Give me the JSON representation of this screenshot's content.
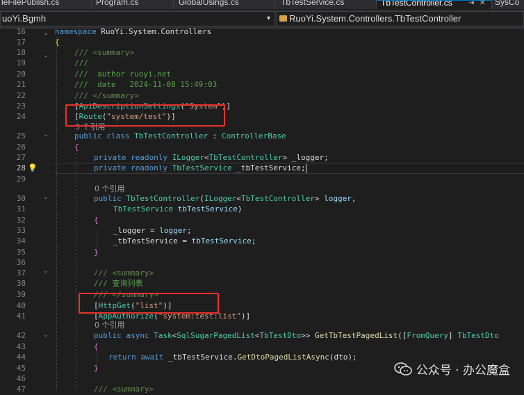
{
  "tabs": [
    {
      "label": "leFilePublish.cs"
    },
    {
      "label": "Program.cs"
    },
    {
      "label": "GlobalUsings.cs"
    },
    {
      "label": "TbTestService.cs"
    },
    {
      "label": "TbTestController.cs"
    },
    {
      "label": "SysCo"
    }
  ],
  "nav": {
    "left": "uoYi.Bgmh",
    "right": "RuoYi.System.Controllers.TbTestController"
  },
  "lines": {
    "l16": {
      "num": "16",
      "t1": "namespace",
      "t2": " RuoYi.System.Controllers"
    },
    "l17": {
      "num": "17",
      "t1": "{"
    },
    "l18": {
      "num": "18",
      "t1": "/// <summary>"
    },
    "l19": {
      "num": "19",
      "t1": "///"
    },
    "l20": {
      "num": "20",
      "t1": "///  author ruoyi.net"
    },
    "l21": {
      "num": "21",
      "t1": "///  date   2024-11-08 15:49:03"
    },
    "l22": {
      "num": "22",
      "t1": "/// </summary>"
    },
    "l23": {
      "num": "23",
      "t1": "[",
      "t2": "ApiDescriptionSettings",
      "t3": "(",
      "t4": "\"System\"",
      "t5": ")]"
    },
    "l24": {
      "num": "24",
      "t1": "[",
      "t2": "Route",
      "t3": "(",
      "t4": "\"system/test\"",
      "t5": ")]"
    },
    "l24lens": "3 个引用",
    "l25": {
      "num": "25",
      "t1": "public",
      "t2": " ",
      "t3": "class",
      "t4": " ",
      "t5": "TbTestController",
      "t6": " : ",
      "t7": "ControllerBase"
    },
    "l26": {
      "num": "26",
      "t1": "{"
    },
    "l27": {
      "num": "27",
      "t1": "private",
      "t2": " ",
      "t3": "readonly",
      "t4": " ",
      "t5": "ILogger",
      "t6": "<",
      "t7": "TbTestController",
      "t8": "> _logger;"
    },
    "l28": {
      "num": "28",
      "t1": "private",
      "t2": " ",
      "t3": "readonly",
      "t4": " ",
      "t5": "TbTestService",
      "t6": " _tbTestService;"
    },
    "l29": {
      "num": "29"
    },
    "l29lens": "0 个引用",
    "l30": {
      "num": "30",
      "t1": "public",
      "t2": " ",
      "t3": "TbTestController",
      "t4": "(",
      "t5": "ILogger",
      "t6": "<",
      "t7": "TbTestController",
      "t8": "> ",
      "t9": "logger",
      "t10": ","
    },
    "l31": {
      "num": "31",
      "t1": "TbTestService",
      "t2": " ",
      "t3": "tbTestService",
      "t4": ")"
    },
    "l32": {
      "num": "32",
      "t1": "{"
    },
    "l33": {
      "num": "33",
      "t1": "_logger = ",
      "t2": "logger",
      "t3": ";"
    },
    "l34": {
      "num": "34",
      "t1": "_tbTestService = ",
      "t2": "tbTestService",
      "t3": ";"
    },
    "l35": {
      "num": "35",
      "t1": "}"
    },
    "l36": {
      "num": "36"
    },
    "l37": {
      "num": "37",
      "t1": "/// <summary>"
    },
    "l38": {
      "num": "38",
      "t1": "/// 查询列表"
    },
    "l39": {
      "num": "39",
      "t1": "/// </summary>"
    },
    "l40": {
      "num": "40",
      "t1": "[",
      "t2": "HttpGet",
      "t3": "(",
      "t4": "\"list\"",
      "t5": ")]"
    },
    "l41": {
      "num": "41",
      "t1": "[",
      "t2": "AppAuthorize",
      "t3": "(",
      "t4": "\"system:test:list\"",
      "t5": ")]"
    },
    "l41lens": "0 个引用",
    "l42": {
      "num": "42",
      "t1": "public",
      "t2": " ",
      "t3": "async",
      "t4": " ",
      "t5": "Task",
      "t6": "<",
      "t7": "SqlSugarPagedList",
      "t8": "<",
      "t9": "TbTestDto",
      "t10": ">> ",
      "t11": "GetTbTestPagedList",
      "t12": "([",
      "t13": "FromQuery",
      "t14": "] ",
      "t15": "TbTestDto"
    },
    "l43": {
      "num": "43",
      "t1": "{"
    },
    "l44": {
      "num": "44",
      "t1": "return",
      "t2": " ",
      "t3": "await",
      "t4": " _tbTestService.",
      "t5": "GetDtoPagedListAsync",
      "t6": "(dto);"
    },
    "l45": {
      "num": "45",
      "t1": "}"
    },
    "l46": {
      "num": "46"
    },
    "l47": {
      "num": "47",
      "t1": "/// <summary>"
    }
  },
  "watermark": "公众号 · 办公魔盒",
  "icons": [
    "close-icon",
    "pin-icon",
    "dropdown-icon",
    "lightbulb-icon",
    "wechat-icon",
    "collapse-icon"
  ],
  "colors": {
    "highlight": "#e8322c",
    "keyword": "#569cd6",
    "type": "#4ec9b0",
    "string": "#d69d85",
    "comment": "#57a64a"
  }
}
